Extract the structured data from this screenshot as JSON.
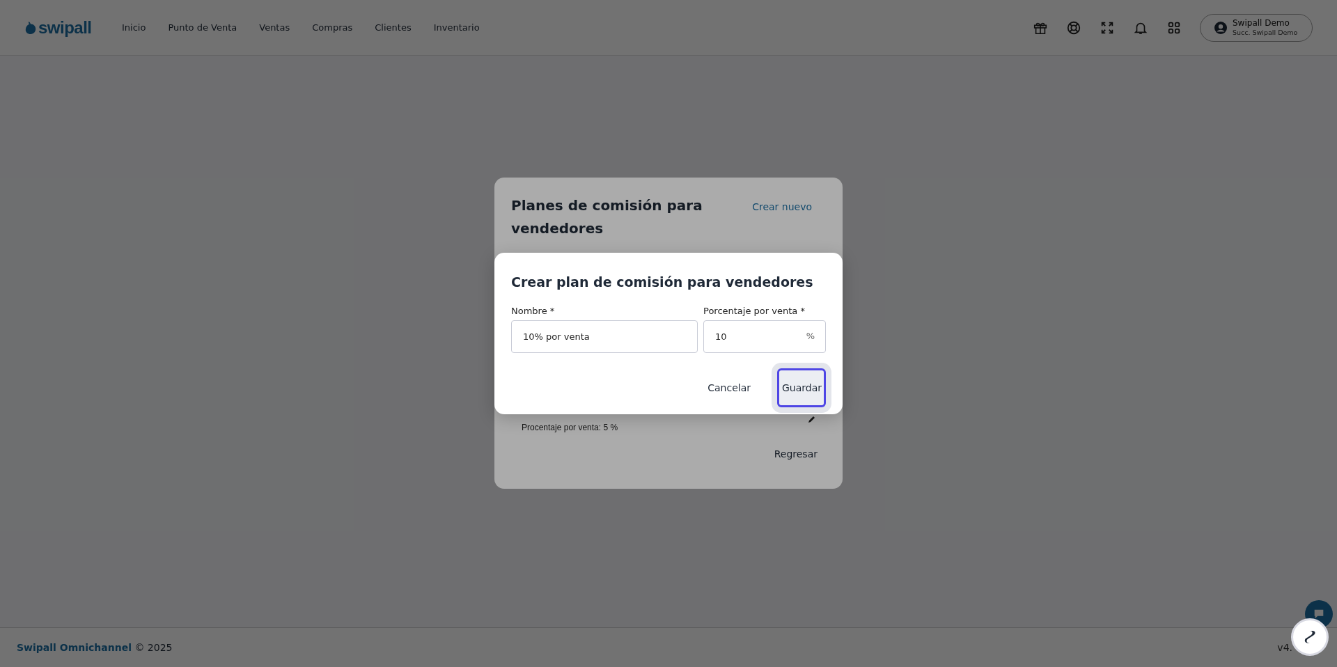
{
  "header": {
    "logo": "swipall",
    "nav": [
      {
        "label": "Inicio"
      },
      {
        "label": "Punto de Venta"
      },
      {
        "label": "Ventas"
      },
      {
        "label": "Compras"
      },
      {
        "label": "Clientes"
      },
      {
        "label": "Inventario"
      }
    ],
    "user": {
      "name": "Swipall Demo",
      "branch": "Succ. Swipall Demo"
    }
  },
  "plans_dialog": {
    "title": "Planes de comisión para vendedores",
    "create_link": "Crear nuevo",
    "plan_detail": "Procentaje por venta: 5 %",
    "back_button": "Regresar"
  },
  "create_dialog": {
    "title": "Crear plan de comisión para vendedores",
    "fields": [
      {
        "label": "Nombre *",
        "value": "10% por venta"
      },
      {
        "label": "Porcentaje por venta *",
        "value": "10",
        "suffix": "%"
      }
    ],
    "buttons": [
      {
        "label": "Cancelar",
        "focused": false
      },
      {
        "label": "Guardar",
        "focused": true
      }
    ]
  },
  "footer": {
    "brand": "Swipall Omnichannel",
    "copyright": "© 2025",
    "version": "v4."
  }
}
